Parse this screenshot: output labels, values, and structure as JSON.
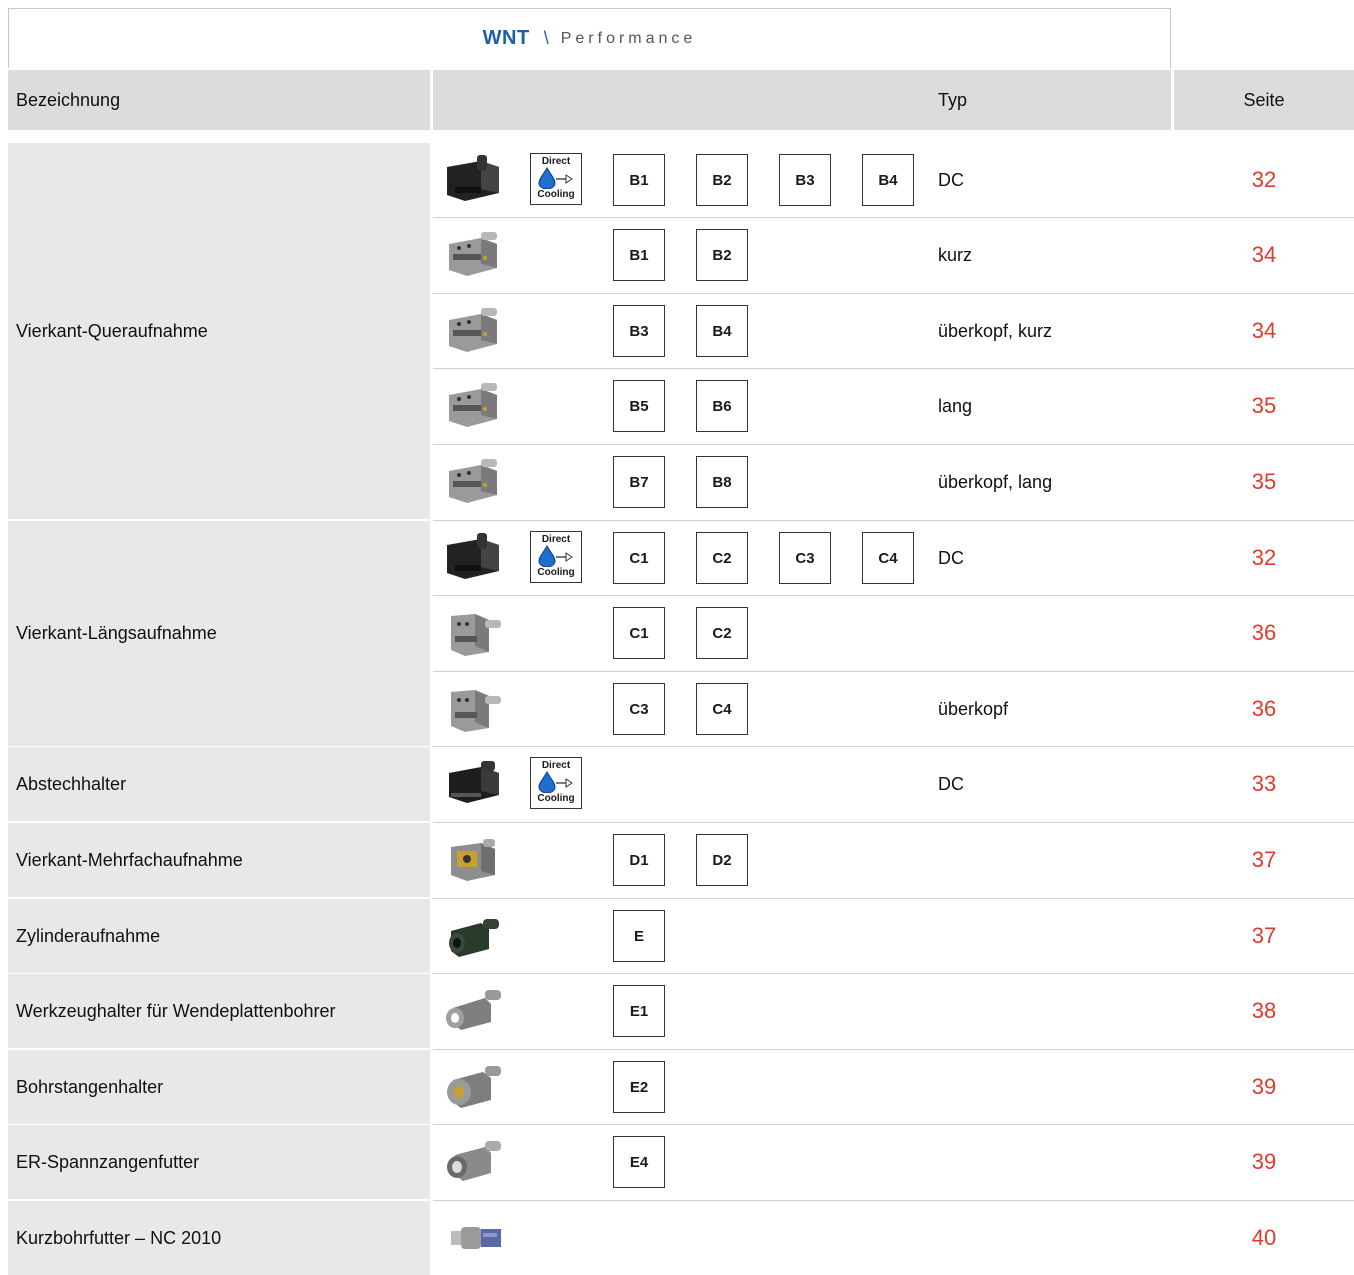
{
  "brand": {
    "logo": "WNT",
    "separator": "\\",
    "subtitle": "Performance"
  },
  "header": {
    "name": "Bezeichnung",
    "type": "Typ",
    "page": "Seite"
  },
  "dc_badge": {
    "line1": "Direct",
    "line2": "Cooling"
  },
  "colors": {
    "brand": "#1d5fa8",
    "page_number": "#e03a2a",
    "header_bg": "#dcdcdc",
    "group_bg": "#e8e8e8"
  },
  "groups": [
    {
      "name": "Vierkant-Queraufnahme"
    },
    {
      "name": "Vierkant-Längsaufnahme"
    },
    {
      "name": "Abstechhalter"
    },
    {
      "name": "Vierkant-Mehrfachaufnahme"
    },
    {
      "name": "Zylinderaufnahme"
    },
    {
      "name": "Werkzeughalter für Wendeplattenbohrer"
    },
    {
      "name": "Bohrstangenhalter"
    },
    {
      "name": "ER-Spannzangenfutter"
    },
    {
      "name": "Kurzbohrfutter – NC 2010"
    }
  ],
  "rows": [
    {
      "icon": "vdi-block-black-icon",
      "codes": [
        "B1",
        "B2",
        "B3",
        "B4"
      ],
      "typ": "DC",
      "page": "32"
    },
    {
      "icon": "vdi-block-radial-icon",
      "codes": [
        "B1",
        "B2"
      ],
      "typ": "kurz",
      "page": "34"
    },
    {
      "icon": "vdi-block-radial-icon",
      "codes": [
        "B3",
        "B4"
      ],
      "typ": "überkopf, kurz",
      "page": "34"
    },
    {
      "icon": "vdi-block-radial-icon",
      "codes": [
        "B5",
        "B6"
      ],
      "typ": "lang",
      "page": "35"
    },
    {
      "icon": "vdi-block-radial-icon",
      "codes": [
        "B7",
        "B8"
      ],
      "typ": "überkopf, lang",
      "page": "35"
    },
    {
      "icon": "vdi-block-black-icon",
      "codes": [
        "C1",
        "C2",
        "C3",
        "C4"
      ],
      "typ": "DC",
      "page": "32"
    },
    {
      "icon": "vdi-block-axial-icon",
      "codes": [
        "C1",
        "C2"
      ],
      "typ": "",
      "page": "36"
    },
    {
      "icon": "vdi-block-axial-icon",
      "codes": [
        "C3",
        "C4"
      ],
      "typ": "überkopf",
      "page": "36"
    },
    {
      "icon": "vdi-cutoff-black-icon",
      "codes": [],
      "typ": "DC",
      "page": "33"
    },
    {
      "icon": "vdi-multi-holder-icon",
      "codes": [
        "D1",
        "D2"
      ],
      "typ": "",
      "page": "37"
    },
    {
      "icon": "vdi-cylinder-holder-icon",
      "codes": [
        "E"
      ],
      "typ": "",
      "page": "37"
    },
    {
      "icon": "vdi-drill-holder-icon",
      "codes": [
        "E1"
      ],
      "typ": "",
      "page": "38"
    },
    {
      "icon": "vdi-boring-bar-holder-icon",
      "codes": [
        "E2"
      ],
      "typ": "",
      "page": "39"
    },
    {
      "icon": "vdi-er-collet-chuck-icon",
      "codes": [
        "E4"
      ],
      "typ": "",
      "page": "39"
    },
    {
      "icon": "vdi-short-drill-chuck-icon",
      "codes": [],
      "typ": "",
      "page": "40"
    }
  ]
}
